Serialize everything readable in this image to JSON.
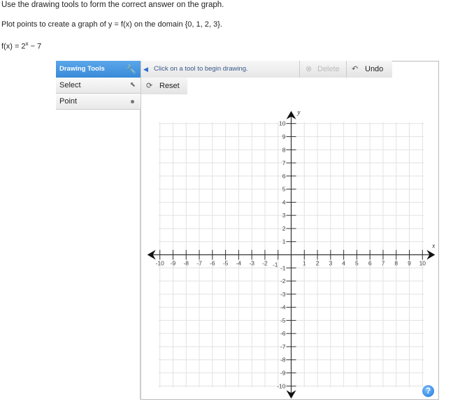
{
  "instructions": {
    "line1": "Use the drawing tools to form the correct answer on the graph.",
    "line2": "Plot points to create a graph of y = f(x) on the domain {0, 1, 2, 3}.",
    "function_lhs": "f(x) = 2",
    "function_exp": "x",
    "function_rhs": " − 7"
  },
  "drawing_tools": {
    "header": "Drawing Tools",
    "header_icon": "wrench-icon",
    "tools": [
      {
        "label": "Select",
        "icon": "cursor-icon"
      },
      {
        "label": "Point",
        "icon": "dot-icon"
      }
    ]
  },
  "toolbar": {
    "message": "Click on a tool to begin drawing.",
    "delete_label": "Delete",
    "undo_label": "Undo",
    "reset_label": "Reset"
  },
  "help_label": "?",
  "chart_data": {
    "type": "scatter",
    "xlabel": "x",
    "ylabel": "y",
    "xlim": [
      -10,
      10
    ],
    "ylim": [
      -10,
      10
    ],
    "xticks": [
      -10,
      -9,
      -8,
      -7,
      -6,
      -5,
      -4,
      -3,
      -2,
      -1,
      1,
      2,
      3,
      4,
      5,
      6,
      7,
      8,
      9,
      10
    ],
    "yticks": [
      -10,
      -9,
      -8,
      -7,
      -6,
      -5,
      -4,
      -3,
      -2,
      -1,
      1,
      2,
      3,
      4,
      5,
      6,
      7,
      8,
      9,
      10
    ],
    "grid": true,
    "points": []
  }
}
